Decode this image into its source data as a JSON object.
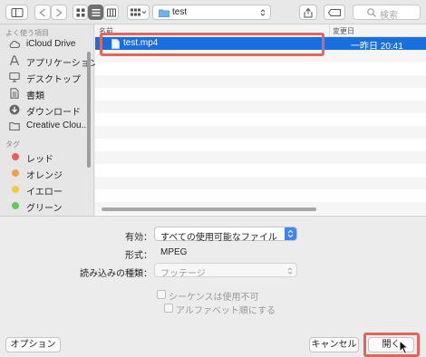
{
  "toolbar": {
    "path": "test",
    "search_placeholder": "検索"
  },
  "sidebar": {
    "favorites_header": "よく使う項目",
    "favorites": [
      {
        "label": "iCloud Drive",
        "icon": "cloud-icon"
      },
      {
        "label": "アプリケーション",
        "icon": "applications-icon"
      },
      {
        "label": "デスクトップ",
        "icon": "desktop-icon"
      },
      {
        "label": "書類",
        "icon": "documents-icon"
      },
      {
        "label": "ダウンロード",
        "icon": "downloads-icon"
      },
      {
        "label": "Creative Clou...",
        "icon": "folder-icon"
      }
    ],
    "tags_header": "タグ",
    "tags": [
      {
        "label": "レッド",
        "color": "#f05a5a"
      },
      {
        "label": "オレンジ",
        "color": "#f5a044"
      },
      {
        "label": "イエロー",
        "color": "#f2cc3b"
      },
      {
        "label": "グリーン",
        "color": "#5ccd5a"
      }
    ]
  },
  "filelist": {
    "col_name": "名前",
    "col_date": "変更日",
    "files": [
      {
        "name": "test.mp4",
        "date": "一昨日 20:41",
        "selected": true
      }
    ]
  },
  "options": {
    "enable_label": "有効：",
    "enable_value": "すべての使用可能なファイル",
    "format_label": "形式：",
    "format_value": "MPEG",
    "import_type_label": "読み込みの種類：",
    "import_type_value": "フッテージ",
    "sequence_label": "シーケンスは使用不可",
    "alpha_label": "アルファベット順にする"
  },
  "buttons": {
    "options": "オプション",
    "cancel": "キャンセル",
    "open": "開く"
  },
  "colors": {
    "selection": "#1a6fde",
    "highlight_box": "#e0655a"
  }
}
